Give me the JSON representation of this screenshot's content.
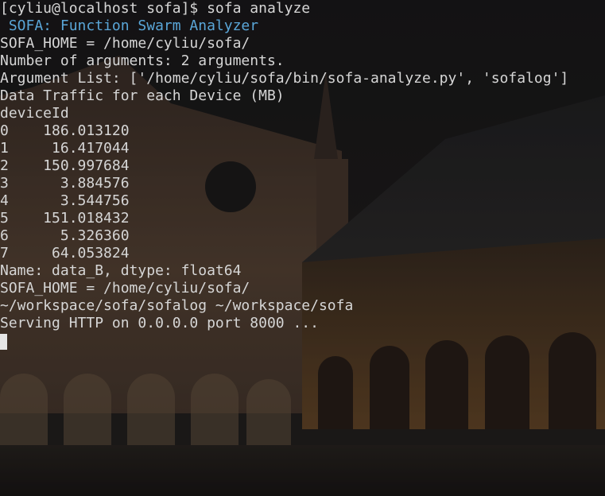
{
  "colors": {
    "foreground": "#d6d6d6",
    "banner": "#5aa6d8",
    "cursor": "#e6e6e6"
  },
  "terminal": {
    "lines": [
      {
        "text": "[cyliu@localhost sofa]$ sofa analyze",
        "style": "normal"
      },
      {
        "text": " SOFA: Function Swarm Analyzer",
        "style": "banner"
      },
      {
        "text": "SOFA_HOME = /home/cyliu/sofa/",
        "style": "normal"
      },
      {
        "text": "Number of arguments: 2 arguments.",
        "style": "normal"
      },
      {
        "text": "Argument List: ['/home/cyliu/sofa/bin/sofa-analyze.py', 'sofalog']",
        "style": "normal"
      },
      {
        "text": "Data Traffic for each Device (MB)",
        "style": "normal"
      },
      {
        "text": "deviceId",
        "style": "normal"
      },
      {
        "text": "0    186.013120",
        "style": "normal"
      },
      {
        "text": "1     16.417044",
        "style": "normal"
      },
      {
        "text": "2    150.997684",
        "style": "normal"
      },
      {
        "text": "3      3.884576",
        "style": "normal"
      },
      {
        "text": "4      3.544756",
        "style": "normal"
      },
      {
        "text": "5    151.018432",
        "style": "normal"
      },
      {
        "text": "6      5.326360",
        "style": "normal"
      },
      {
        "text": "7     64.053824",
        "style": "normal"
      },
      {
        "text": "Name: data_B, dtype: float64",
        "style": "normal"
      },
      {
        "text": "SOFA_HOME = /home/cyliu/sofa/",
        "style": "normal"
      },
      {
        "text": "~/workspace/sofa/sofalog ~/workspace/sofa",
        "style": "normal"
      },
      {
        "text": "Serving HTTP on 0.0.0.0 port 8000 ...",
        "style": "normal"
      }
    ]
  }
}
